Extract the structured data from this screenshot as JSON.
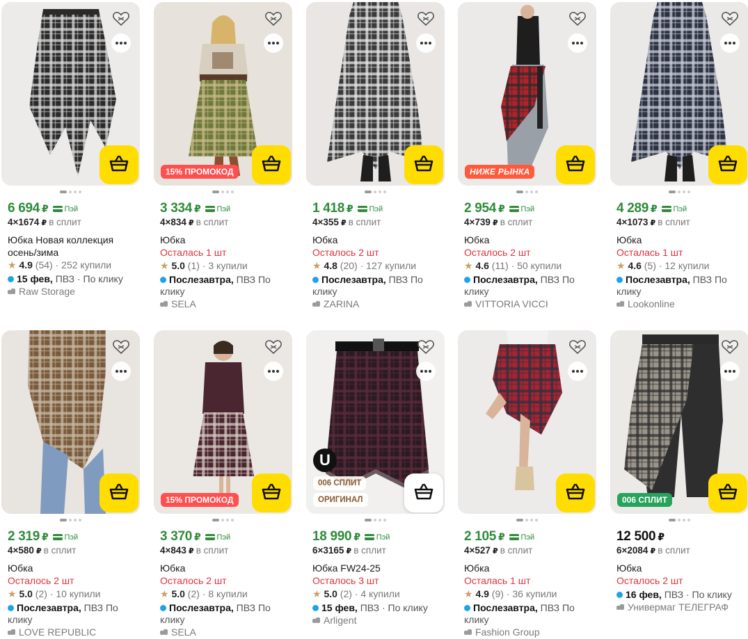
{
  "currency": "₽",
  "pay_label": "Пэй",
  "split_suffix": "в сплит",
  "colors": {
    "price_green": "#2e8b3a",
    "cart_yellow": "#ffdd00",
    "stock_red": "#e0313a",
    "delivery_blue": "#1fa3e8"
  },
  "icons": {
    "favorite": "heart-outline-icon",
    "more": "more-dots-icon",
    "cart": "basket-icon",
    "star": "star-icon",
    "seller": "shop-icon"
  },
  "products": [
    {
      "price": "6 694",
      "pay": true,
      "split": "4×1674",
      "title": "Юбка Новая коллекция осень/зима",
      "stock": "",
      "rating": "4.9",
      "reviews": "(54)",
      "bought": "· 252 купили",
      "delivery_bold": "15 фев,",
      "delivery_rest": " ПВЗ · По клику",
      "seller": "Raw Storage",
      "badge": "",
      "badge2": "",
      "photo": {
        "bg": "#ecebea",
        "c1": "#2a2a2a",
        "c2": "#d9d9d9",
        "shape": "hem"
      }
    },
    {
      "price": "3 334",
      "pay": true,
      "split": "4×834",
      "title": "Юбка",
      "stock": "Осталась 1 шт",
      "rating": "5.0",
      "reviews": "(1)",
      "bought": "· 3 купили",
      "delivery_bold": "Послезавтра,",
      "delivery_rest": " ПВЗ По клику",
      "seller": "SELA",
      "badge": "15% ПРОМОКОД",
      "badge2": "",
      "photo": {
        "bg": "#e7e3dc",
        "c1": "#6e7a3a",
        "c2": "#c9b98a",
        "shape": "model"
      }
    },
    {
      "price": "1 418",
      "pay": true,
      "split": "4×355",
      "title": "Юбка",
      "stock": "Осталось 2 шт",
      "rating": "4.8",
      "reviews": "(20)",
      "bought": "· 127 купили",
      "delivery_bold": "Послезавтра,",
      "delivery_rest": " ПВЗ По клику",
      "seller": "ZARINA",
      "badge": "",
      "badge2": "",
      "photo": {
        "bg": "#e9e6e3",
        "c1": "#3a3a3a",
        "c2": "#e8e8e8",
        "shape": "long"
      }
    },
    {
      "price": "2 954",
      "pay": true,
      "split": "4×739",
      "title": "Юбка",
      "stock": "Осталось 2 шт",
      "rating": "4.6",
      "reviews": "(11)",
      "bought": "· 50 купили",
      "delivery_bold": "Послезавтра,",
      "delivery_rest": " ПВЗ По клику",
      "seller": "VITTORIA VICCI",
      "badge": "НИЖЕ РЫНКА",
      "badge2": "",
      "photo": {
        "bg": "#eceae8",
        "c1": "#b2222c",
        "c2": "#2b2b2b",
        "shape": "wrap"
      }
    },
    {
      "price": "4 289",
      "pay": true,
      "split": "4×1073",
      "title": "Юбка",
      "stock": "Осталась 1 шт",
      "rating": "4.6",
      "reviews": "(5)",
      "bought": "· 12 купили",
      "delivery_bold": "Послезавтра,",
      "delivery_rest": " ПВЗ По клику",
      "seller": "Lookonline",
      "badge": "",
      "badge2": "",
      "photo": {
        "bg": "#ebe9e7",
        "c1": "#2c3242",
        "c2": "#c9ccd6",
        "shape": "long"
      }
    },
    {
      "price": "2 319",
      "pay": true,
      "split": "4×580",
      "title": "Юбка",
      "stock": "Осталось 2 шт",
      "rating": "5.0",
      "reviews": "(2)",
      "bought": "· 10 купили",
      "delivery_bold": "Послезавтра,",
      "delivery_rest": " ПВЗ По клику",
      "seller": "LOVE REPUBLIC",
      "badge": "",
      "badge2": "",
      "photo": {
        "bg": "#e8e4df",
        "c1": "#7a5a3c",
        "c2": "#c8b9a5",
        "shape": "wrapjeans"
      }
    },
    {
      "price": "3 370",
      "pay": true,
      "split": "4×843",
      "title": "Юбка",
      "stock": "Осталось 2 шт",
      "rating": "5.0",
      "reviews": "(2)",
      "bought": "· 8 купили",
      "delivery_bold": "Послезавтра,",
      "delivery_rest": " ПВЗ По клику",
      "seller": "SELA",
      "badge": "15% ПРОМОКОД",
      "badge2": "",
      "photo": {
        "bg": "#ebe8e4",
        "c1": "#4a2630",
        "c2": "#d7c9c3",
        "shape": "model2"
      }
    },
    {
      "price": "18 990",
      "pay": true,
      "split": "6×3165",
      "title": "Юбка FW24-25",
      "stock": "Осталось 3 шт",
      "rating": "5.0",
      "reviews": "(2)",
      "bought": "· 4 купили",
      "delivery_bold": "15 фев,",
      "delivery_rest": " ПВЗ · По клику",
      "seller": "Arligent",
      "badge": "ОРИГИНАЛ",
      "badge2": "006 СПЛИТ",
      "photo": {
        "bg": "#f1f0ef",
        "c1": "#2a1a22",
        "c2": "#5a2a3a",
        "shape": "dark"
      }
    },
    {
      "price": "2 105",
      "pay": true,
      "split": "4×527",
      "title": "Юбка",
      "stock": "Осталась 1 шт",
      "rating": "4.9",
      "reviews": "(9)",
      "bought": "· 36 купили",
      "delivery_bold": "Послезавтра,",
      "delivery_rest": " ПВЗ По клику",
      "seller": "Fashion Group",
      "badge": "",
      "badge2": "",
      "photo": {
        "bg": "#ecebe9",
        "c1": "#a82430",
        "c2": "#2d3040",
        "shape": "wrap2"
      }
    },
    {
      "price": "12 500",
      "pay": false,
      "split": "6×2084",
      "title": "Юбка",
      "stock": "Осталось 2 шт",
      "rating": "",
      "reviews": "",
      "bought": "",
      "delivery_bold": "16 фев,",
      "delivery_rest": " ПВЗ · По клику",
      "seller": "Универмаг ТЕЛЕГРАФ",
      "badge": "006 СПЛИТ",
      "badge2": "",
      "photo": {
        "bg": "#eceae7",
        "c1": "#9a948a",
        "c2": "#2e2e2e",
        "shape": "pants"
      }
    }
  ]
}
